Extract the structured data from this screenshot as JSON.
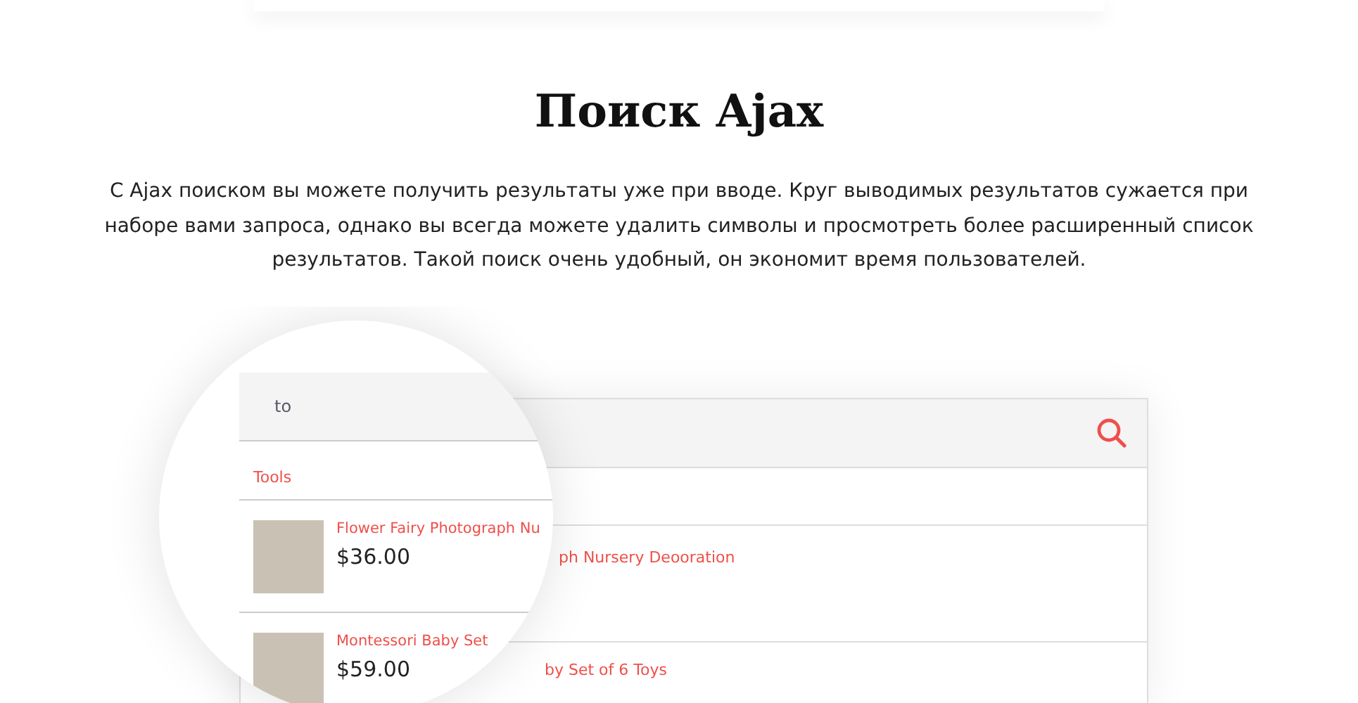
{
  "heading": "Поиск Ajax",
  "description": "С Ajax поиском вы можете получить результаты уже при вводе. Круг выводимых результатов сужается при наборе вами запроса, однако вы всегда можете удалить символы и просмотреть более расширенный список результатов. Такой поиск очень удобный, он экономит время пользователей.",
  "background_panel": {
    "results": [
      {
        "title": "ph Nursery Deooration"
      },
      {
        "title": "by Set of 6 Toys"
      }
    ]
  },
  "magnifier": {
    "search": {
      "value": "to"
    },
    "category": "Tools",
    "results": [
      {
        "title": "Flower Fairy Photograph Nu",
        "price": "$36.00"
      },
      {
        "title": "Montessori Baby Set",
        "price": "$59.00"
      }
    ]
  }
}
